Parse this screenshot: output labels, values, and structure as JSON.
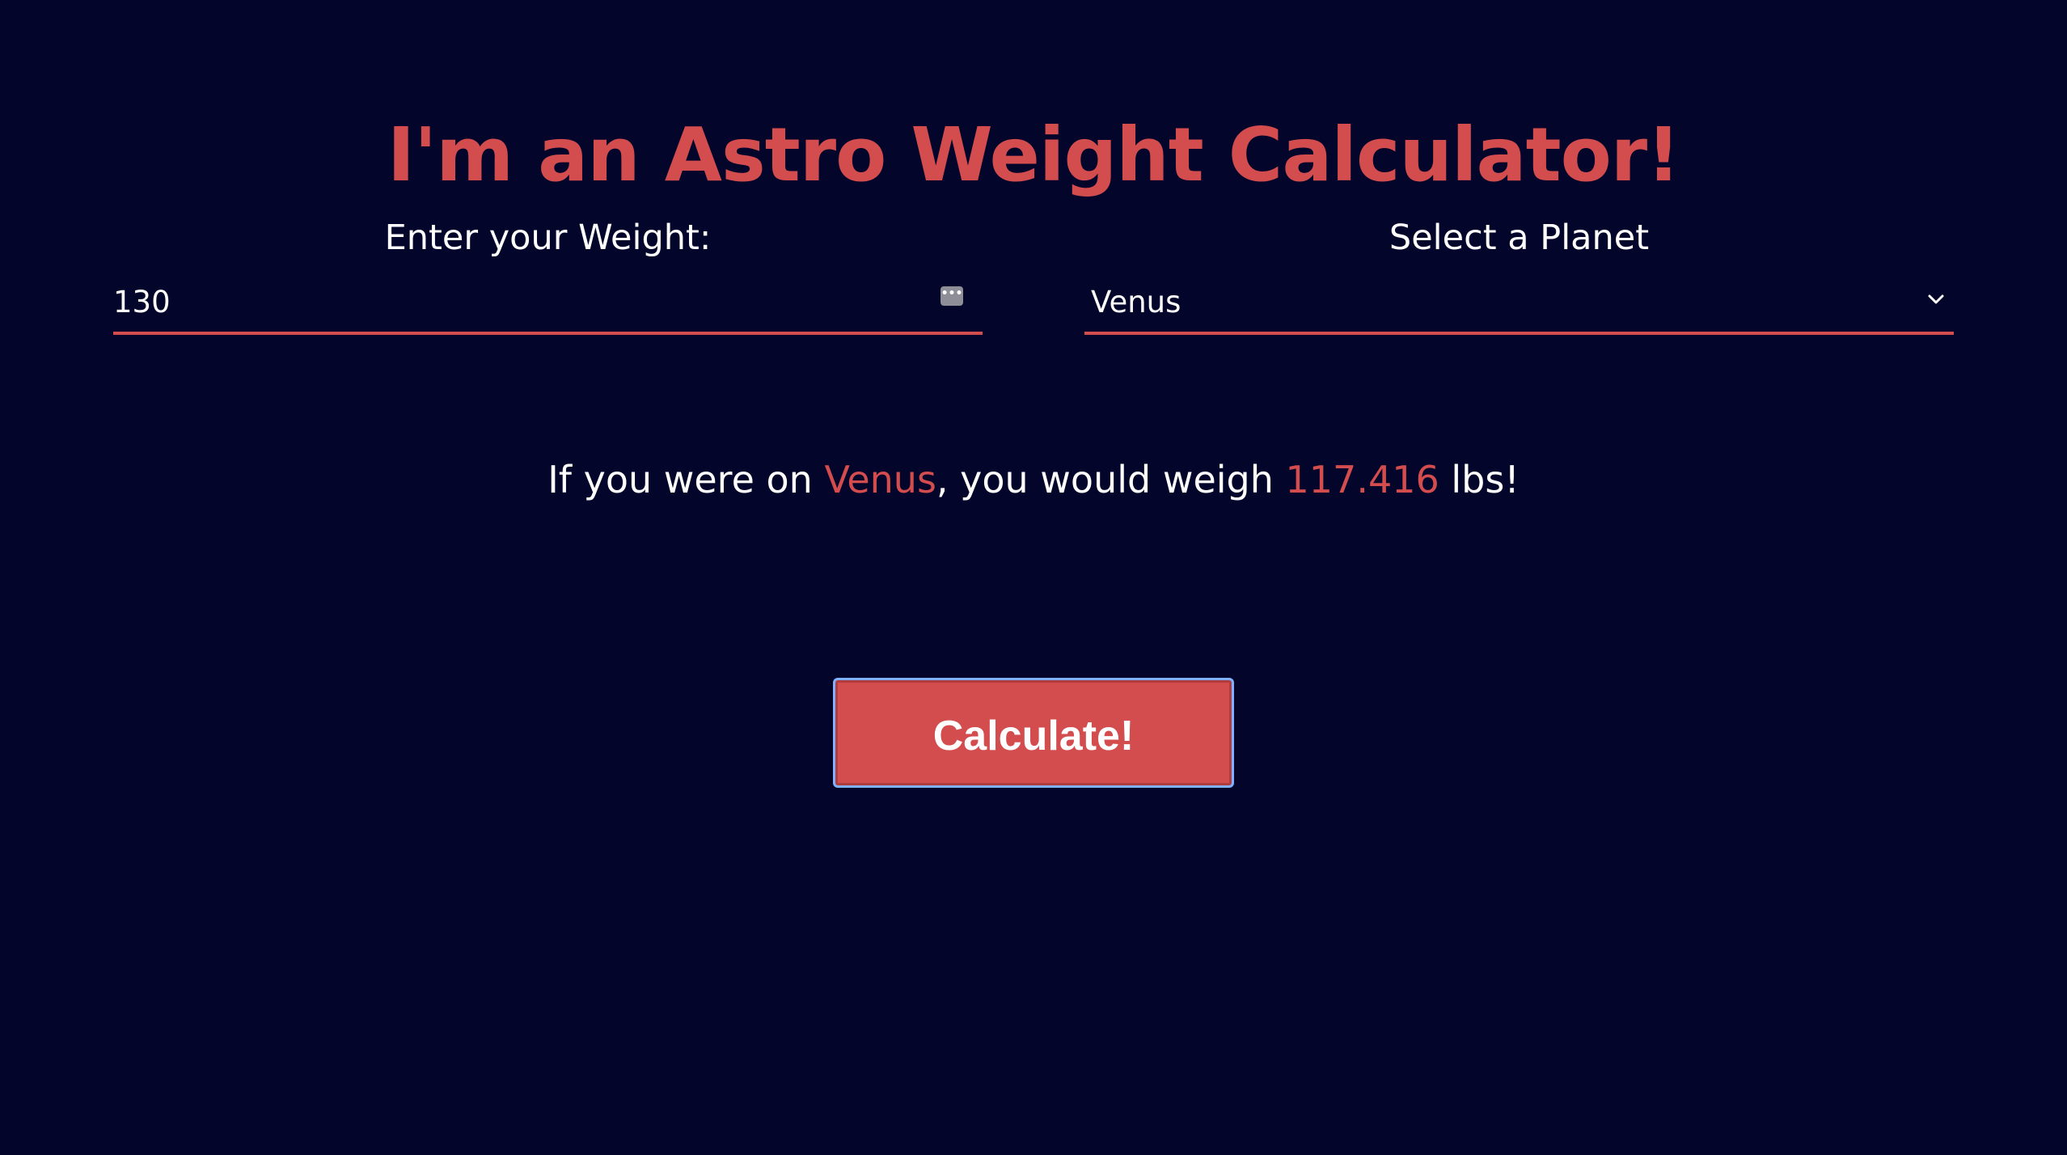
{
  "header": {
    "title": "I'm an Astro Weight Calculator!"
  },
  "form": {
    "weight_label": "Enter your Weight:",
    "weight_value": "130",
    "planet_label": "Select a Planet",
    "planet_value": "Venus"
  },
  "result": {
    "prefix": "If you were on ",
    "planet": "Venus",
    "middle": ", you would weigh ",
    "weight": "117.416",
    "suffix": " lbs!"
  },
  "actions": {
    "calculate_label": "Calculate!"
  },
  "icons": {
    "weight_field_icon": "ellipsis-icon",
    "planet_field_icon": "chevron-down-icon"
  },
  "colors": {
    "background": "#03052a",
    "accent": "#d34c4e",
    "text": "#ffffff",
    "focus_ring": "#7fb1ff"
  }
}
